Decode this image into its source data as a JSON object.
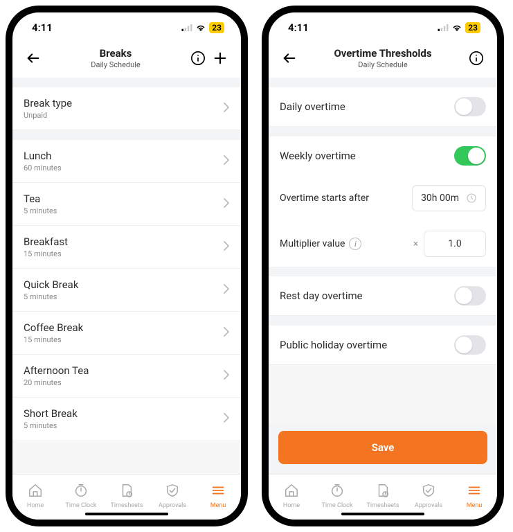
{
  "status": {
    "time": "4:11",
    "battery": "23"
  },
  "left": {
    "title": "Breaks",
    "subtitle": "Daily Schedule",
    "breakType": {
      "label": "Break type",
      "value": "Unpaid"
    },
    "breaks": [
      {
        "name": "Lunch",
        "duration": "60 minutes"
      },
      {
        "name": "Tea",
        "duration": "5 minutes"
      },
      {
        "name": "Breakfast",
        "duration": "15 minutes"
      },
      {
        "name": "Quick Break",
        "duration": "5 minutes"
      },
      {
        "name": "Coffee Break",
        "duration": "15 minutes"
      },
      {
        "name": "Afternoon Tea",
        "duration": "20 minutes"
      },
      {
        "name": "Short Break",
        "duration": "5 minutes"
      }
    ]
  },
  "right": {
    "title": "Overtime Thresholds",
    "subtitle": "Daily Schedule",
    "daily": {
      "label": "Daily overtime",
      "on": false
    },
    "weekly": {
      "label": "Weekly overtime",
      "on": true,
      "startsAfterLabel": "Overtime starts after",
      "startsAfterValue": "30h 00m",
      "multiplierLabel": "Multiplier value",
      "multiplierValue": "1.0"
    },
    "restDay": {
      "label": "Rest day overtime",
      "on": false
    },
    "publicHoliday": {
      "label": "Public holiday overtime",
      "on": false
    },
    "saveLabel": "Save"
  },
  "tabs": [
    {
      "label": "Home"
    },
    {
      "label": "Time Clock"
    },
    {
      "label": "Timesheets"
    },
    {
      "label": "Approvals"
    },
    {
      "label": "Menu"
    }
  ]
}
